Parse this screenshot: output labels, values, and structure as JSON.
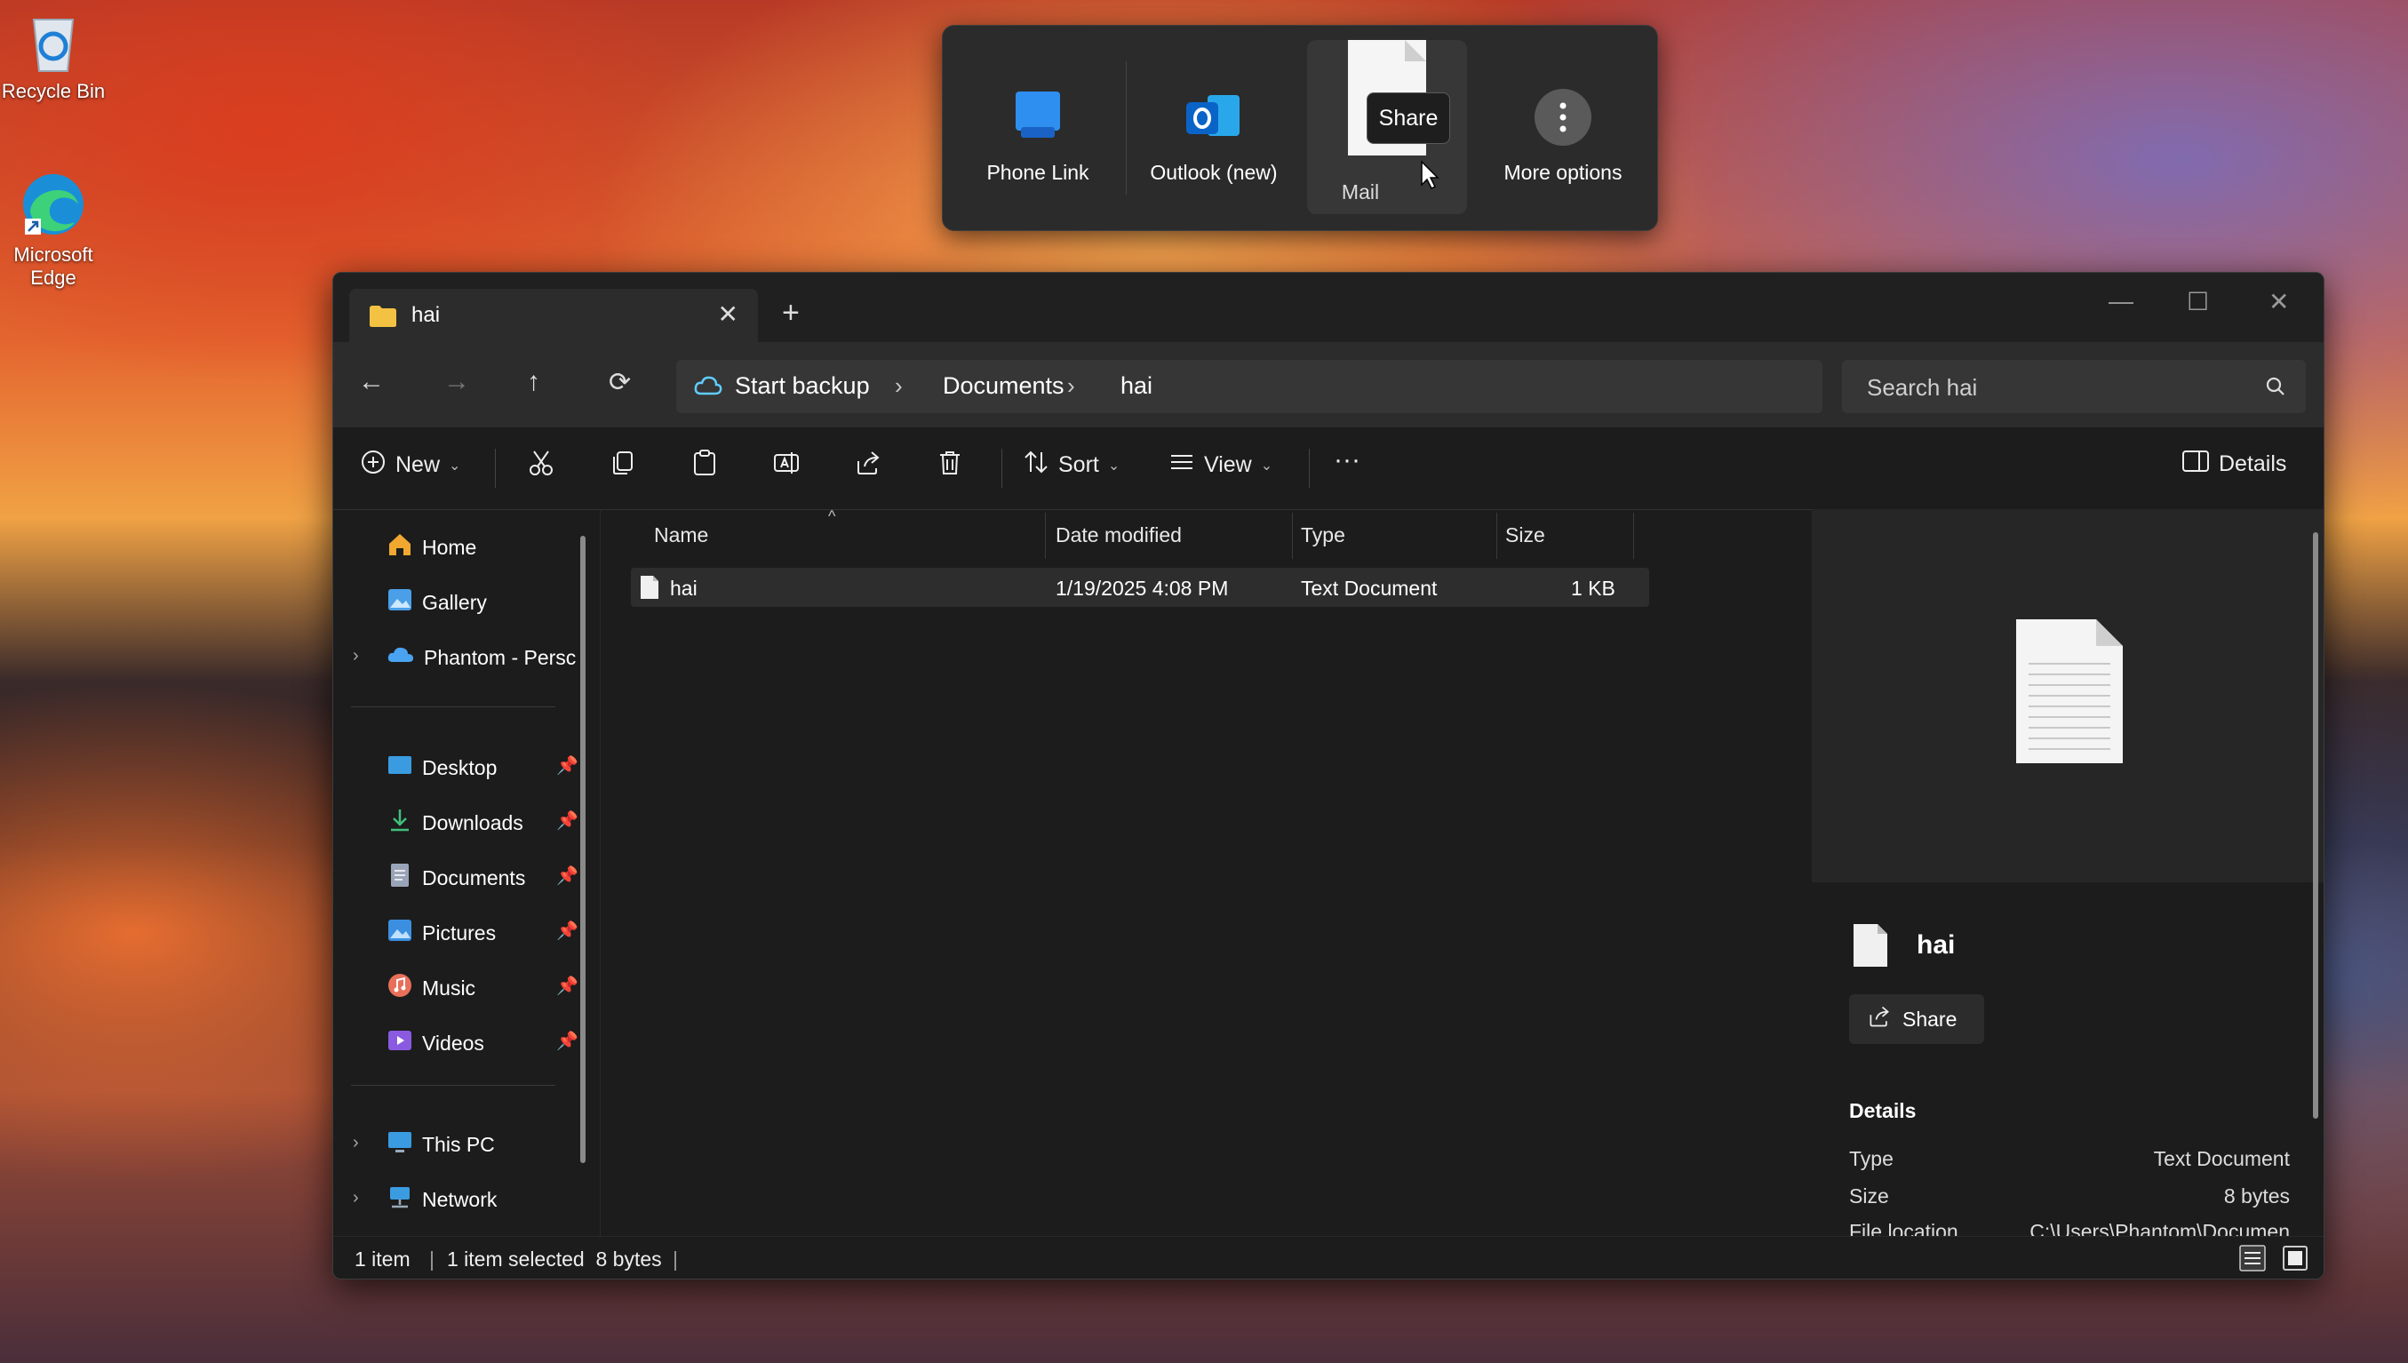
{
  "desktop": {
    "icons": [
      {
        "label": "Recycle Bin"
      },
      {
        "label": "Microsoft Edge"
      }
    ]
  },
  "share_popup": {
    "items": [
      {
        "label": "Phone Link",
        "icon": "phone-link-icon"
      },
      {
        "label": "Outlook (new)",
        "icon": "outlook-icon"
      },
      {
        "label": "Mail",
        "icon": "mail-icon"
      },
      {
        "label": "More options",
        "icon": "more-options-icon"
      }
    ],
    "tooltip": "Share"
  },
  "window": {
    "tab_title": "hai",
    "new_tab": "+",
    "breadcrumb": [
      "Start backup",
      "Documents",
      "hai"
    ],
    "search_placeholder": "Search hai",
    "toolbar": {
      "new_label": "New",
      "sort_label": "Sort",
      "view_label": "View",
      "more_label": "···",
      "details_label": "Details"
    },
    "sidebar": {
      "top": [
        {
          "label": "Home"
        },
        {
          "label": "Gallery"
        },
        {
          "label": "Phantom - Persc"
        }
      ],
      "pinned": [
        {
          "label": "Desktop"
        },
        {
          "label": "Downloads"
        },
        {
          "label": "Documents"
        },
        {
          "label": "Pictures"
        },
        {
          "label": "Music"
        },
        {
          "label": "Videos"
        }
      ],
      "bottom": [
        {
          "label": "This PC"
        },
        {
          "label": "Network"
        }
      ]
    },
    "columns": [
      "Name",
      "Date modified",
      "Type",
      "Size"
    ],
    "files": [
      {
        "name": "hai",
        "date": "1/19/2025 4:08 PM",
        "type": "Text Document",
        "size": "1 KB"
      }
    ],
    "preview": {
      "filename": "hai",
      "share_label": "Share",
      "details_heading": "Details",
      "props": [
        {
          "key": "Type",
          "value": "Text Document"
        },
        {
          "key": "Size",
          "value": "8 bytes"
        },
        {
          "key": "File location",
          "value": "C:\\Users\\Phantom\\Documen"
        }
      ]
    },
    "status": {
      "count": "1 item",
      "selected": "1 item selected  8 bytes"
    }
  },
  "colors": {
    "accent": "#60cdff",
    "folder": "#f3c242",
    "window_bg": "#1c1c1c"
  }
}
